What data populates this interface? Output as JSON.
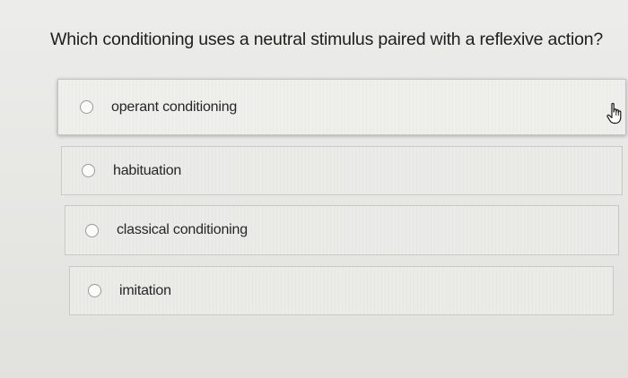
{
  "question": {
    "text": "Which conditioning uses a neutral stimulus paired with a reflexive action?"
  },
  "options": [
    {
      "label": "operant conditioning",
      "selected": false
    },
    {
      "label": "habituation",
      "selected": false
    },
    {
      "label": "classical conditioning",
      "selected": false
    },
    {
      "label": "imitation",
      "selected": false
    }
  ],
  "cursor": {
    "icon": "hand-pointer-icon"
  }
}
